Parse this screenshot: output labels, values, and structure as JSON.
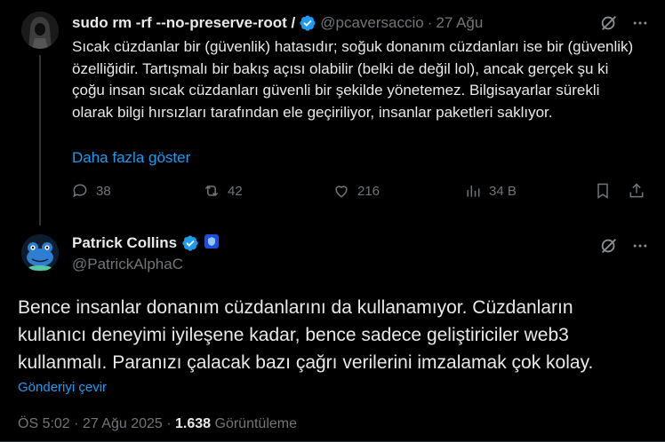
{
  "parent": {
    "name": "sudo rm -rf --no-preserve-root /",
    "handle": "@pcaversaccio",
    "date": "27 Ağu",
    "text": "Sıcak cüzdanlar bir (güvenlik) hatasıdır; soğuk donanım cüzdanları ise bir (güvenlik) özelliğidir. Tartışmalı bir bakış açısı olabilir (belki de değil lol), ancak gerçek şu ki çoğu insan sıcak cüzdanları güvenli bir şekilde yönetemez. Bilgisayarlar sürekli olarak bilgi hırsızları tarafından ele geçiriliyor, insanlar paketleri saklıyor.",
    "show_more": "Daha fazla göster",
    "replies": "38",
    "reposts": "42",
    "likes": "216",
    "views": "34 B"
  },
  "reply": {
    "name": "Patrick Collins",
    "handle": "@PatrickAlphaC",
    "text": "Bence insanlar donanım cüzdanlarını da kullanamıyor. Cüzdanların kullanıcı deneyimi iyileşene kadar, bence sadece geliştiriciler web3 kullanmalı. Paranızı çalacak bazı çağrı verilerini imzalamak çok kolay.",
    "translate": "Gönderiyi çevir",
    "time": "ÖS 5:02 · 27 Ağu 2025 · ",
    "view_count": "1.638",
    "view_label": " Görüntüleme"
  },
  "icons": {
    "verified": "verified-badge-icon",
    "grok": "grok-icon",
    "more": "more-icon",
    "reply": "reply-icon",
    "repost": "repost-icon",
    "like": "heart-icon",
    "views": "analytics-icon",
    "bookmark": "bookmark-icon",
    "share": "share-icon"
  },
  "colors": {
    "background": "#000000",
    "text": "#e7e9ea",
    "muted": "#71767b",
    "link": "#1d9bf0",
    "verified": "#1d9bf0"
  }
}
